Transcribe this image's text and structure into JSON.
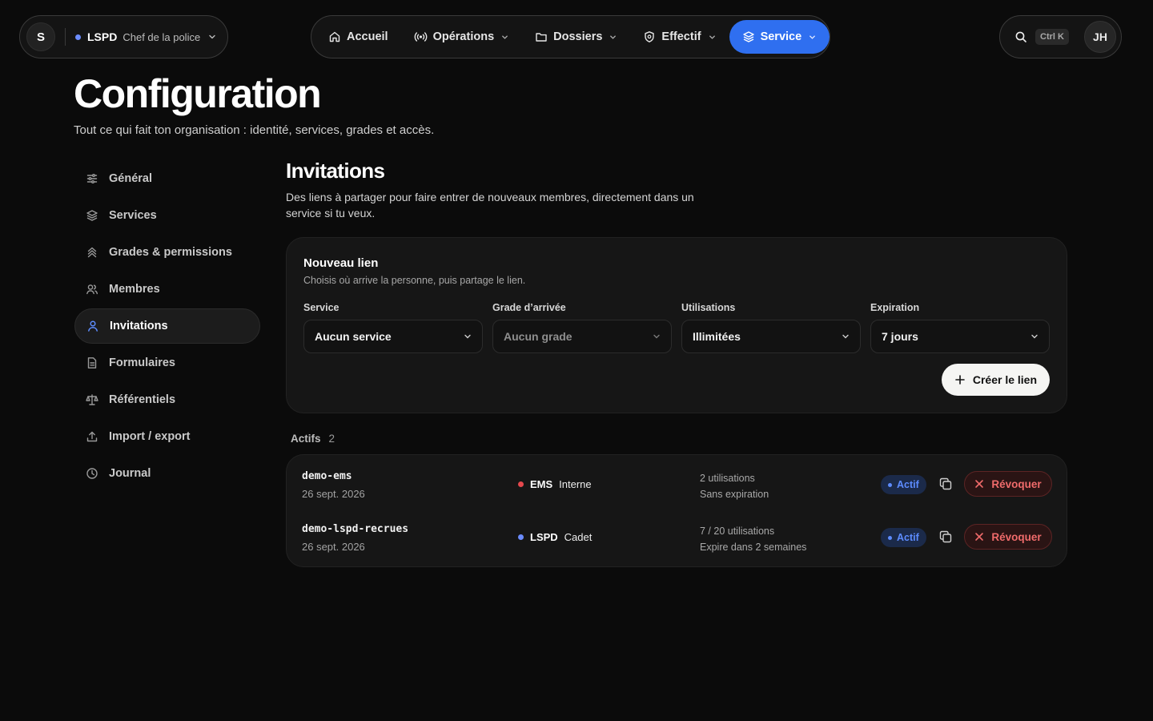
{
  "org": {
    "avatar_letter": "S",
    "name": "LSPD",
    "role": "Chef de la police",
    "accent": "#6b8cff"
  },
  "nav": {
    "items": [
      {
        "label": "Accueil",
        "icon": "home-icon",
        "has_chevron": false,
        "active": false
      },
      {
        "label": "Opérations",
        "icon": "broadcast-icon",
        "has_chevron": true,
        "active": false
      },
      {
        "label": "Dossiers",
        "icon": "folder-icon",
        "has_chevron": true,
        "active": false
      },
      {
        "label": "Effectif",
        "icon": "shield-icon",
        "has_chevron": true,
        "active": false
      },
      {
        "label": "Service",
        "icon": "layers-icon",
        "has_chevron": true,
        "active": true
      }
    ],
    "active_color": "#2f6ff0"
  },
  "topright": {
    "shortcut": "Ctrl K",
    "user_initials": "JH"
  },
  "header": {
    "title": "Configuration",
    "subtitle": "Tout ce qui fait ton organisation : identité, services, grades et accès."
  },
  "sidebar": {
    "items": [
      {
        "label": "Général",
        "icon": "sliders-icon",
        "active": false
      },
      {
        "label": "Services",
        "icon": "layers-icon",
        "active": false
      },
      {
        "label": "Grades & permissions",
        "icon": "chevrons-up-icon",
        "active": false
      },
      {
        "label": "Membres",
        "icon": "users-icon",
        "active": false
      },
      {
        "label": "Invitations",
        "icon": "user-icon",
        "active": true
      },
      {
        "label": "Formulaires",
        "icon": "file-icon",
        "active": false
      },
      {
        "label": "Référentiels",
        "icon": "scale-icon",
        "active": false
      },
      {
        "label": "Import / export",
        "icon": "upload-icon",
        "active": false
      },
      {
        "label": "Journal",
        "icon": "clock-icon",
        "active": false
      }
    ]
  },
  "section": {
    "title": "Invitations",
    "description": "Des liens à partager pour faire entrer de nouveaux membres, directement dans un service si tu veux."
  },
  "new_link": {
    "title": "Nouveau lien",
    "description": "Choisis où arrive la personne, puis partage le lien.",
    "fields": [
      {
        "label": "Service",
        "value": "Aucun service",
        "muted": false
      },
      {
        "label": "Grade d’arrivée",
        "value": "Aucun grade",
        "muted": true
      },
      {
        "label": "Utilisations",
        "value": "Illimitées",
        "muted": false
      },
      {
        "label": "Expiration",
        "value": "7 jours",
        "muted": false
      }
    ],
    "create_label": "Créer le lien"
  },
  "active_list": {
    "heading": "Actifs",
    "count": "2",
    "rows": [
      {
        "code": "demo-ems",
        "date": "26 sept. 2026",
        "service": "EMS",
        "service_color": "#e5484d",
        "grade": "Interne",
        "usage": "2 utilisations",
        "expiry": "Sans expiration",
        "status": "Actif",
        "revoke_label": "Révoquer"
      },
      {
        "code": "demo-lspd-recrues",
        "date": "26 sept. 2026",
        "service": "LSPD",
        "service_color": "#6b8cff",
        "grade": "Cadet",
        "usage": "7 / 20 utilisations",
        "expiry": "Expire dans 2 semaines",
        "status": "Actif",
        "revoke_label": "Révoquer"
      }
    ]
  }
}
